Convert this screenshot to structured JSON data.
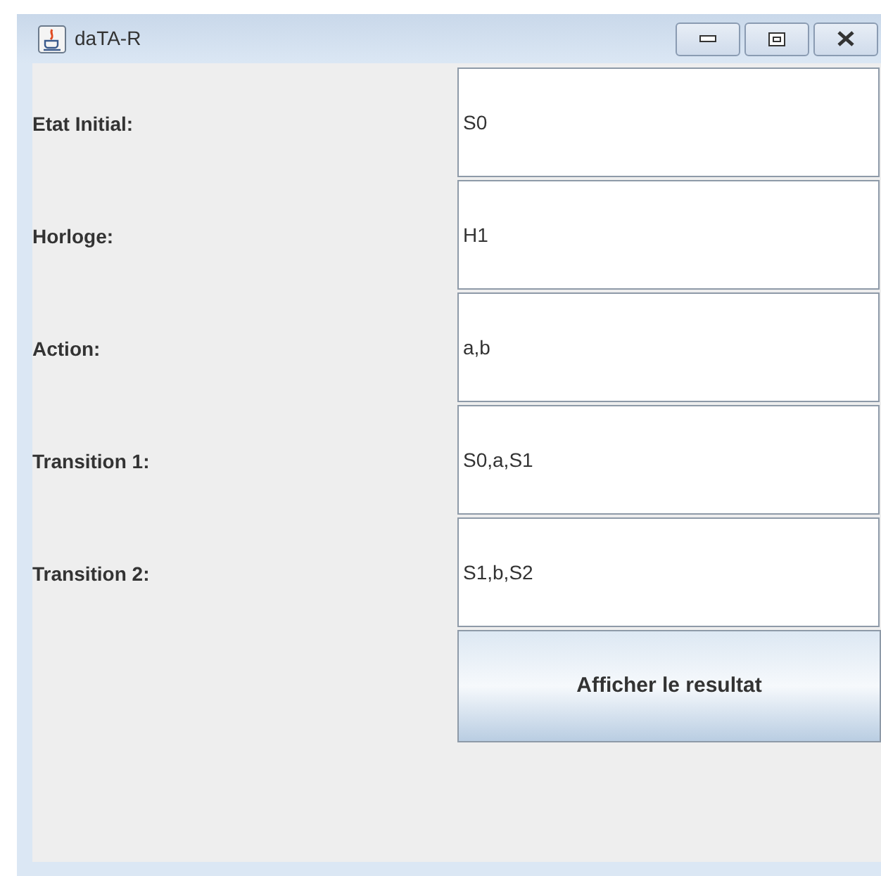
{
  "window": {
    "title": "daTA-R"
  },
  "fields": [
    {
      "label": "Etat Initial:",
      "value": "S0"
    },
    {
      "label": "Horloge:",
      "value": "H1"
    },
    {
      "label": "Action:",
      "value": "a,b"
    },
    {
      "label": "Transition 1:",
      "value": "S0,a,S1"
    },
    {
      "label": "Transition 2:",
      "value": "S1,b,S2"
    }
  ],
  "button": {
    "label": "Afficher le resultat"
  }
}
